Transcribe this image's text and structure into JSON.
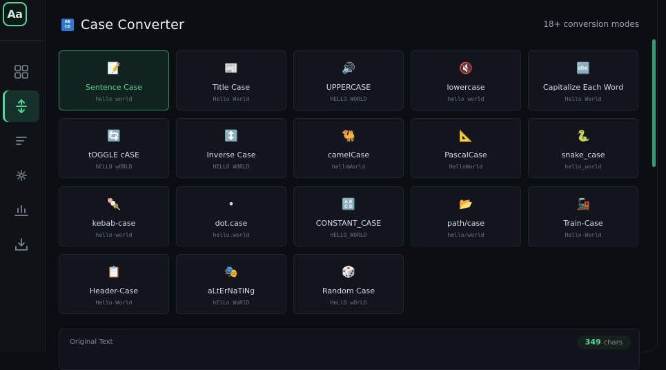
{
  "app": {
    "logo_text": "Aa"
  },
  "sidebar": {
    "items": [
      {
        "icon": "grid-icon",
        "active": false
      },
      {
        "icon": "convert-arrows-icon",
        "active": true
      },
      {
        "icon": "text-lines-icon",
        "active": false
      },
      {
        "icon": "sparkle-icon",
        "active": false
      },
      {
        "icon": "bar-chart-icon",
        "active": false
      },
      {
        "icon": "download-icon",
        "active": false
      }
    ]
  },
  "header": {
    "icon_text": "AB CD",
    "title": "Case Converter",
    "modes_count": "18+ conversion modes"
  },
  "modes": [
    {
      "emoji": "📝",
      "name": "Sentence Case",
      "sample": "hello world",
      "active": true
    },
    {
      "emoji": "📰",
      "name": "Title Case",
      "sample": "Hello World"
    },
    {
      "emoji": "🔊",
      "name": "UPPERCASE",
      "sample": "HELLO WORLD"
    },
    {
      "emoji": "🔇",
      "name": "lowercase",
      "sample": "hello world"
    },
    {
      "emoji": "🔤",
      "name": "Capitalize Each Word",
      "sample": "Hello World"
    },
    {
      "emoji": "🔄",
      "name": "tOGGLE cASE",
      "sample": "hELLO wORLD"
    },
    {
      "emoji": "↕️",
      "name": "Inverse Case",
      "sample": "HELLO WORLD"
    },
    {
      "emoji": "🐫",
      "name": "camelCase",
      "sample": "helloWorld"
    },
    {
      "emoji": "📐",
      "name": "PascalCase",
      "sample": "HelloWorld"
    },
    {
      "emoji": "🐍",
      "name": "snake_case",
      "sample": "hello_world"
    },
    {
      "emoji": "🍡",
      "name": "kebab-case",
      "sample": "hello-world"
    },
    {
      "emoji": "•",
      "name": "dot.case",
      "sample": "hello.world"
    },
    {
      "emoji": "🔠",
      "name": "CONSTANT_CASE",
      "sample": "HELLO_WORLD"
    },
    {
      "emoji": "📂",
      "name": "path/case",
      "sample": "hello/world"
    },
    {
      "emoji": "🚂",
      "name": "Train-Case",
      "sample": "Hello-World"
    },
    {
      "emoji": "📋",
      "name": "Header-Case",
      "sample": "Hello-World"
    },
    {
      "emoji": "🎭",
      "name": "aLtErNaTiNg",
      "sample": "hElLo WoRlD"
    },
    {
      "emoji": "🎲",
      "name": "Random Case",
      "sample": "HeLlO wOrLD"
    }
  ],
  "input_panel": {
    "label": "Original Text",
    "char_count": "349",
    "char_unit": "chars"
  },
  "colors": {
    "accent": "#4fd89a",
    "background": "#0b0e13",
    "card": "#12161c"
  }
}
